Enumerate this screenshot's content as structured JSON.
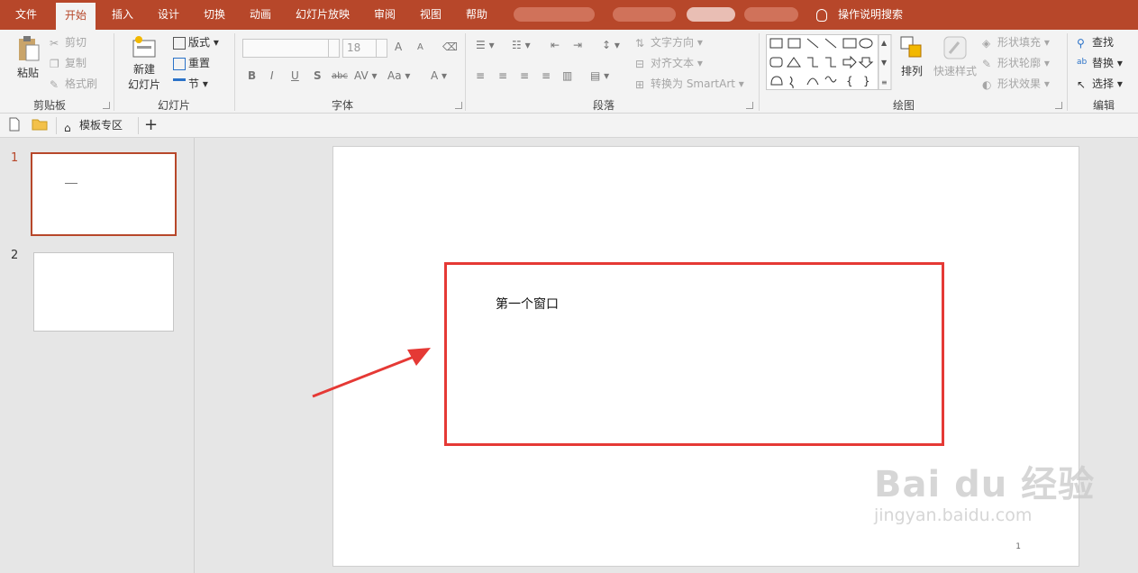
{
  "tabs": [
    "文件",
    "开始",
    "插入",
    "设计",
    "切换",
    "动画",
    "幻灯片放映",
    "审阅",
    "视图",
    "帮助"
  ],
  "active_tab": "开始",
  "tell_me": "操作说明搜索",
  "clipboard": {
    "paste": "粘贴",
    "cut": "剪切",
    "copy": "复制",
    "format_painter": "格式刷",
    "label": "剪贴板"
  },
  "slides_group": {
    "new_slide_line1": "新建",
    "new_slide_line2": "幻灯片",
    "layout": "版式",
    "reset": "重置",
    "section": "节",
    "label": "幻灯片"
  },
  "font_group": {
    "size_placeholder": "18",
    "bold": "B",
    "italic": "I",
    "underline": "U",
    "shadow": "S",
    "strike": "abc",
    "spacing": "AV",
    "case": "Aa",
    "color": "A",
    "grow": "A",
    "shrink": "A",
    "label": "字体"
  },
  "paragraph_group": {
    "text_direction": "文字方向",
    "align_text": "对齐文本",
    "smartart": "转换为 SmartArt",
    "label": "段落"
  },
  "drawing_group": {
    "arrange": "排列",
    "quick_styles": "快速样式",
    "shape_fill": "形状填充",
    "shape_outline": "形状轮廓",
    "shape_effects": "形状效果",
    "label": "绘图"
  },
  "editing_group": {
    "find": "查找",
    "replace": "替换",
    "select": "选择",
    "label": "编辑"
  },
  "qbar": {
    "template_zone": "模板专区",
    "add": "+"
  },
  "slides": [
    {
      "number": "1",
      "selected": true
    },
    {
      "number": "2",
      "selected": false
    }
  ],
  "slide_content": {
    "text": "第一个窗口",
    "page_number": "1"
  },
  "watermark": {
    "main": "Bai du 经验",
    "sub": "jingyan.baidu.com"
  },
  "colors": {
    "accent": "#b7472a",
    "highlight": "#e53935"
  }
}
